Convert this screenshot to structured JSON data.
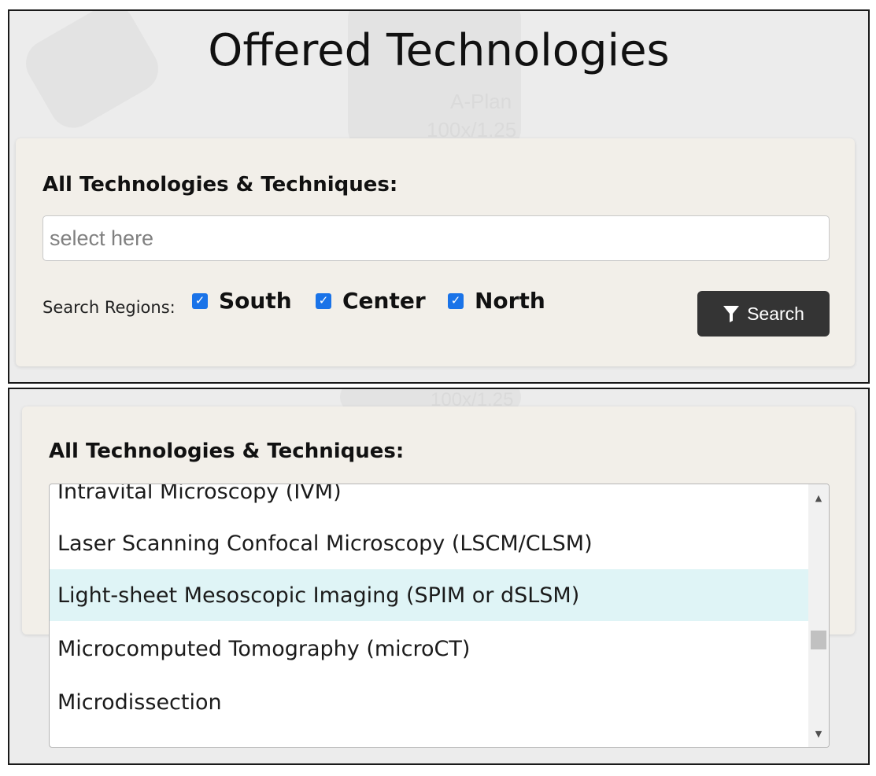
{
  "top_panel": {
    "title": "Offered Technologies",
    "card": {
      "label": "All Technologies & Techniques:",
      "input_placeholder": "select here",
      "regions_label": "Search Regions:",
      "regions": [
        {
          "label": "South",
          "checked": true
        },
        {
          "label": "Center",
          "checked": true
        },
        {
          "label": "North",
          "checked": true
        }
      ],
      "search_button_label": "Search",
      "search_button_icon": "funnel-icon"
    }
  },
  "bottom_panel": {
    "card": {
      "label": "All Technologies & Techniques:"
    },
    "dropdown": {
      "items": [
        {
          "label": "Intravital Microscopy (IVM)",
          "highlighted": false
        },
        {
          "label": "Laser Scanning Confocal Microscopy (LSCM/CLSM)",
          "highlighted": false
        },
        {
          "label": "Light-sheet Mesoscopic Imaging (SPIM or dSLSM)",
          "highlighted": true
        },
        {
          "label": "Microcomputed Tomography (microCT)",
          "highlighted": false
        },
        {
          "label": "Microdissection",
          "highlighted": false
        }
      ],
      "highlight_color": "#dff4f6"
    }
  },
  "colors": {
    "checkbox": "#1a73e8",
    "button_bg": "#343434",
    "card_bg": "#f2efe9"
  }
}
